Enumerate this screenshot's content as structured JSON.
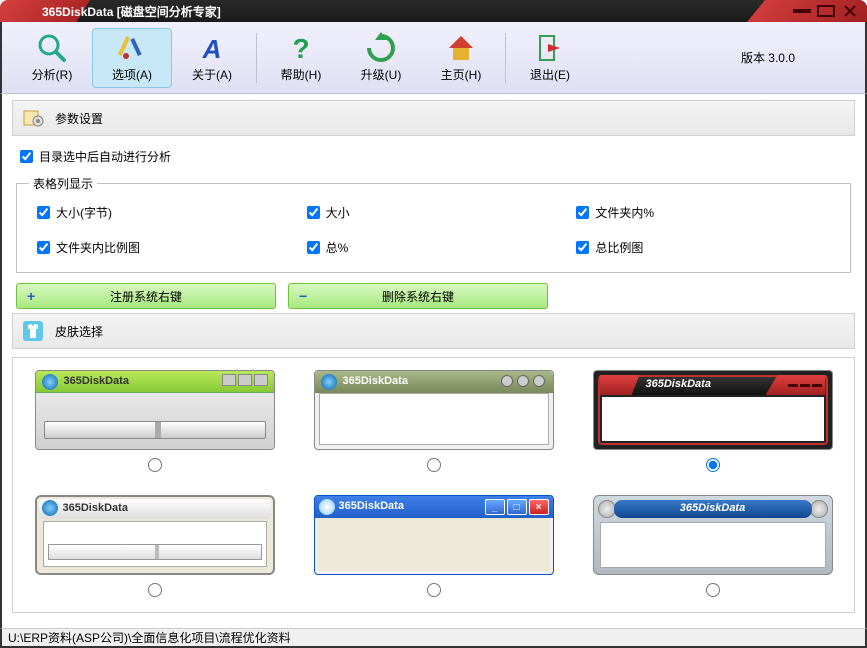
{
  "title": "365DiskData [磁盘空间分析专家]",
  "version": "版本 3.0.0",
  "toolbar": {
    "analyze": "分析(R)",
    "options": "选项(A)",
    "about": "关于(A)",
    "help": "帮助(H)",
    "upgrade": "升级(U)",
    "home": "主页(H)",
    "exit": "退出(E)"
  },
  "sections": {
    "params": "参数设置",
    "skin": "皮肤选择"
  },
  "params": {
    "auto_analyze": "目录选中后自动进行分析",
    "fieldset": "表格列显示",
    "checks": {
      "size_bytes": "大小(字节)",
      "size": "大小",
      "folder_pct": "文件夹内%",
      "folder_ratio_chart": "文件夹内比例图",
      "total_pct": "总%",
      "total_ratio_chart": "总比例图"
    },
    "btn_register": "注册系统右键",
    "btn_unregister": "删除系统右键"
  },
  "skins": {
    "preview_title": "365DiskData"
  },
  "statusbar": "U:\\ERP资料(ASP公司)\\全面信息化项目\\流程优化资料"
}
